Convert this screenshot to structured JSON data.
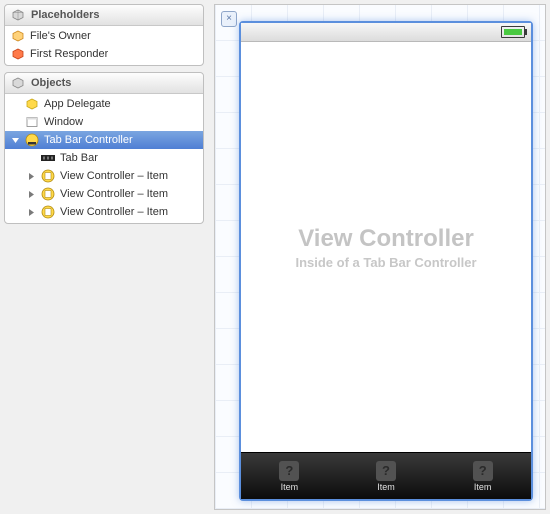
{
  "outline": {
    "placeholders": {
      "title": "Placeholders",
      "items": [
        {
          "icon": "cube-orange",
          "label": "File's Owner"
        },
        {
          "icon": "cube-red",
          "label": "First Responder"
        }
      ]
    },
    "objects": {
      "title": "Objects",
      "items": [
        {
          "icon": "cube-yellow",
          "label": "App Delegate",
          "indent": 0,
          "disclosure": "none"
        },
        {
          "icon": "window",
          "label": "Window",
          "indent": 0,
          "disclosure": "none"
        },
        {
          "icon": "tabbar-controller",
          "label": "Tab Bar Controller",
          "indent": 0,
          "disclosure": "down",
          "selected": true
        },
        {
          "icon": "tabbar",
          "label": "Tab Bar",
          "indent": 1,
          "disclosure": "none"
        },
        {
          "icon": "view-controller",
          "label": "View Controller – Item",
          "indent": 1,
          "disclosure": "right"
        },
        {
          "icon": "view-controller",
          "label": "View Controller – Item",
          "indent": 1,
          "disclosure": "right"
        },
        {
          "icon": "view-controller",
          "label": "View Controller – Item",
          "indent": 1,
          "disclosure": "right"
        }
      ]
    }
  },
  "canvas": {
    "content_title": "View Controller",
    "content_sub": "Inside of a Tab Bar Controller",
    "tabs": [
      {
        "label": "Item"
      },
      {
        "label": "Item"
      },
      {
        "label": "Item"
      }
    ]
  }
}
